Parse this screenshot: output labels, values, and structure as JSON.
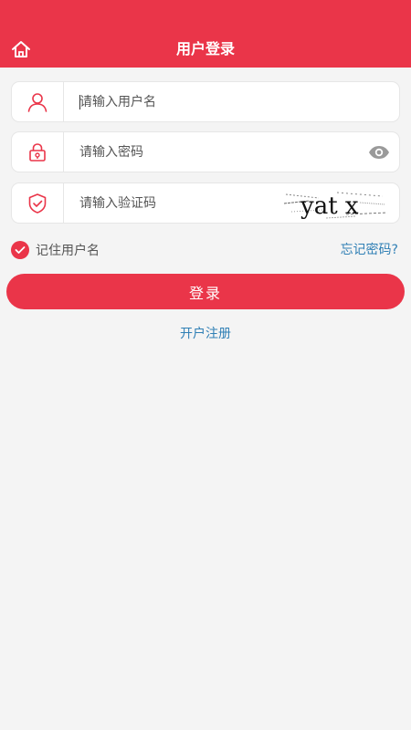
{
  "colors": {
    "accent": "#ea3549",
    "link": "#2f7fb5",
    "background": "#f4f4f4"
  },
  "header": {
    "title": "用户登录",
    "home_icon": "home-icon"
  },
  "form": {
    "username": {
      "placeholder": "请输入用户名",
      "value": "",
      "icon": "user-icon"
    },
    "password": {
      "placeholder": "请输入密码",
      "value": "",
      "icon": "lock-icon",
      "toggle_icon": "eye-icon"
    },
    "captcha": {
      "placeholder": "请输入验证码",
      "value": "",
      "icon": "shield-check-icon",
      "image_text": "yat x"
    }
  },
  "options": {
    "remember_label": "记住用户名",
    "remember_checked": true,
    "forgot_label": "忘记密码?"
  },
  "actions": {
    "login_label": "登录",
    "register_label": "开户注册"
  }
}
